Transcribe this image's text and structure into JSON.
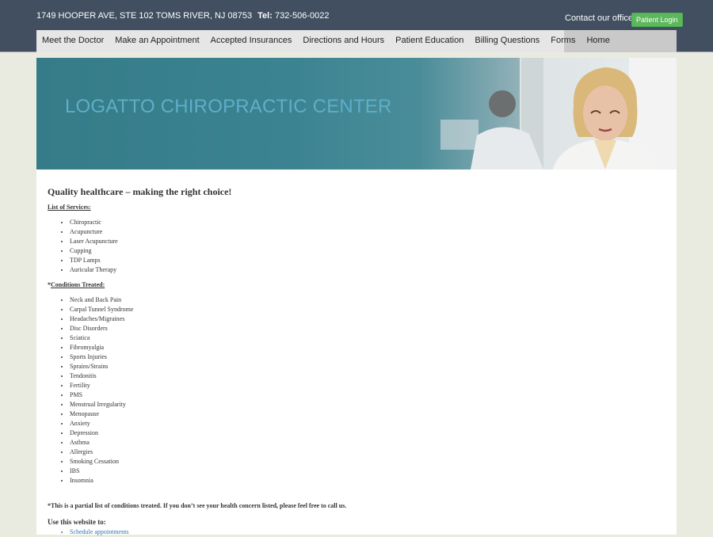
{
  "header": {
    "address": "1749 HOOPER AVE, STE 102 TOMS RIVER, NJ 08753",
    "tel_label": "Tel:",
    "tel_number": "732-506-0022",
    "contact_link": "Contact our office",
    "login_button": "Patient Login"
  },
  "nav": {
    "items": [
      "Meet the Doctor",
      "Make an Appointment",
      "Accepted Insurances",
      "Directions and Hours",
      "Patient Education",
      "Billing Questions",
      "Forms",
      "Home"
    ]
  },
  "banner": {
    "title": "LOGATTO CHIROPRACTIC CENTER"
  },
  "main": {
    "heading": "Quality healthcare – making the right choice!",
    "services_label": "List of Services:",
    "services": [
      "Chiropractic",
      "Acupuncture",
      "Laser Acupuncture",
      "Cupping",
      "TDP Lamps",
      "Auricular Therapy"
    ],
    "conditions_prefix": "*",
    "conditions_label": "Conditions Treated:",
    "conditions": [
      "Neck and Back Pain",
      "Carpal Tunnel Syndrome",
      "Headaches/Migraines",
      "Disc Disorders",
      "Sciatica",
      "Fibromyalgia",
      "Sports Injuries",
      "Sprains/Strains",
      "Tendonitis",
      "Fertility",
      "PMS",
      "Menstrual Irregularity",
      "Menopause",
      "Anxiety",
      "Depression",
      "Asthma",
      "Allergies",
      "Smoking Cessation",
      "IBS",
      "Insomnia"
    ],
    "note": "*This is a partial list of conditions treated. If you don’t see your health concern listed, please feel free to call us.",
    "use_label": "Use this website to:",
    "use_links": [
      "Schedule appointments"
    ]
  },
  "colors": {
    "topbar": "#414f61",
    "login_button": "#5cb85c",
    "banner_teal": "#357b88",
    "link": "#2f74b5"
  }
}
